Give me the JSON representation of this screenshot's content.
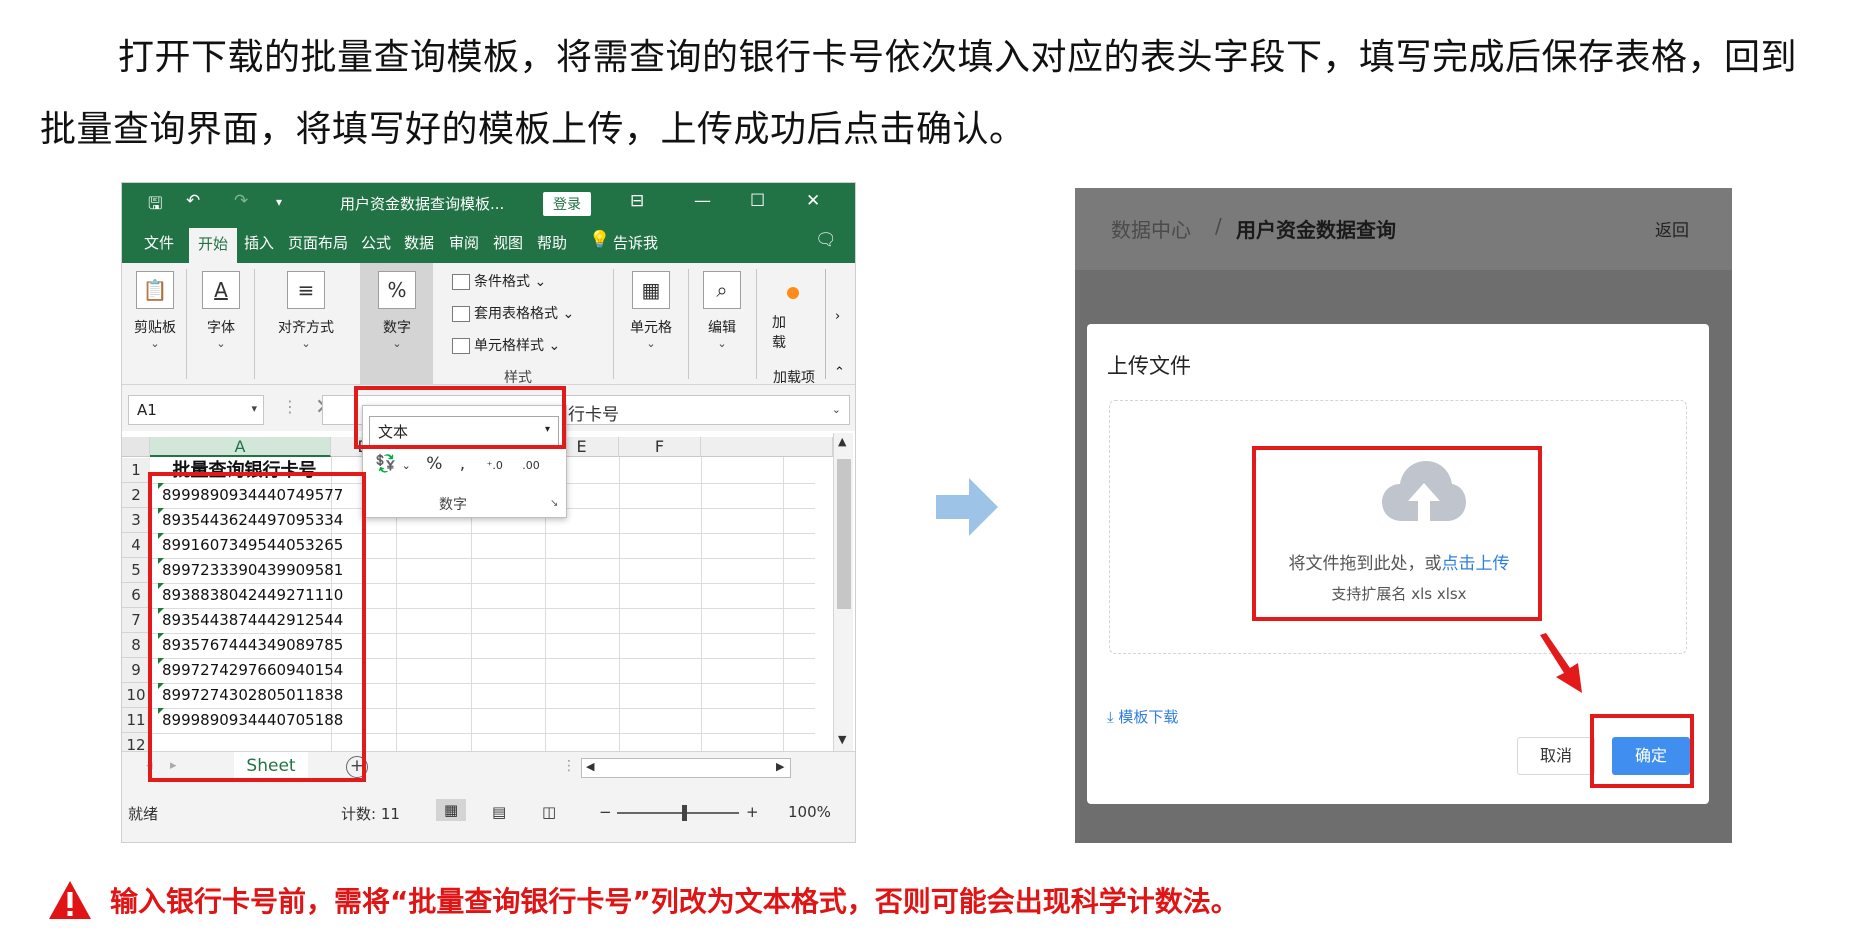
{
  "intro": "打开下载的批量查询模板，将需查询的银行卡号依次填入对应的表头字段下，填写完成后保存表格，回到批量查询界面，将填写好的模板上传，上传成功后点击确认。",
  "excel": {
    "title": "用户资金数据查询模板...",
    "login": "登录",
    "tabs": [
      "文件",
      "开始",
      "插入",
      "页面布局",
      "公式",
      "数据",
      "审阅",
      "视图",
      "帮助",
      "告诉我"
    ],
    "ribbon": {
      "clipboard": "剪贴板",
      "font": "字体",
      "align": "对齐方式",
      "number": "数字",
      "cond_format": "条件格式",
      "table_format": "套用表格格式",
      "cell_style": "单元格样式",
      "styles": "样式",
      "cells": "单元格",
      "edit": "编辑",
      "addin": "加载项",
      "addin_short": "加\n载项"
    },
    "name_box": "A1",
    "formula_text": "行卡号",
    "number_format": "文本",
    "number_group": "数字",
    "columns": [
      "A",
      "B",
      "C",
      "D",
      "E",
      "F"
    ],
    "header_cell": "批量查询银行卡号",
    "rows": [
      "1",
      "2",
      "3",
      "4",
      "5",
      "6",
      "7",
      "8",
      "9",
      "10",
      "11",
      "12"
    ],
    "card_numbers": [
      "8999890934440749577",
      "8935443624497095334",
      "8991607349544053265",
      "8997233390439909581",
      "8938838042449271110",
      "8935443874442912544",
      "8935767444349089785",
      "8997274297660940154",
      "8997274302805011838",
      "8999890934440705188"
    ],
    "sheet_tab": "Sheet",
    "status": "就绪",
    "count": "计数: 11",
    "zoom": "100%"
  },
  "web": {
    "crumb_parent": "数据中心",
    "crumb_sep": "/",
    "crumb_current": "用户资金数据查询",
    "back": "返回",
    "modal_title": "上传文件",
    "drop_text": "将文件拖到此处，或",
    "drop_link": "点击上传",
    "drop_hint": "支持扩展名 xls xlsx",
    "template": "⤓ 模板下载",
    "cancel": "取消",
    "confirm": "确定"
  },
  "warning": "输入银行卡号前，需将“批量查询银行卡号”列改为文本格式，否则可能会出现科学计数法。",
  "colors": {
    "excel_green": "#217346",
    "highlight_red": "#e31a1a",
    "primary_blue": "#3f8ef0",
    "warning_red": "#e01414"
  }
}
